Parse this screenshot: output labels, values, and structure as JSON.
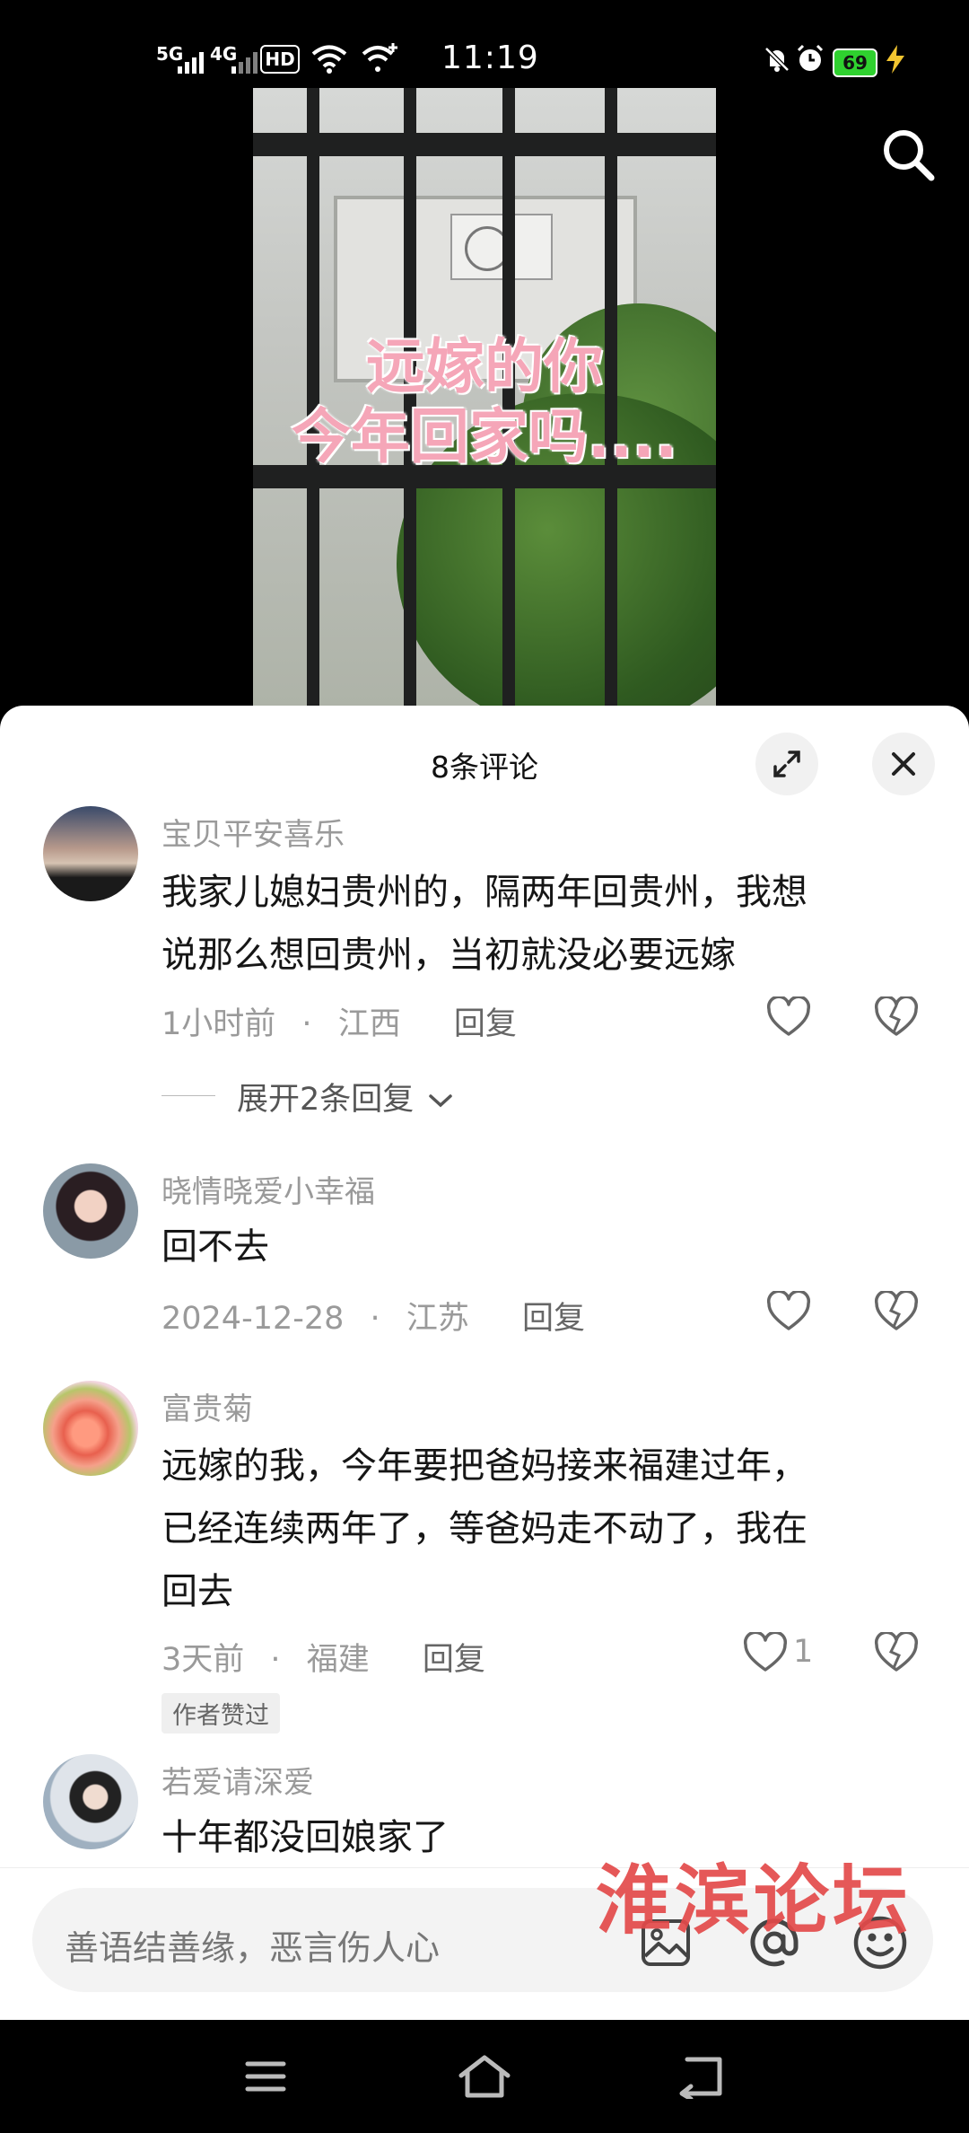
{
  "status_bar": {
    "time": "11:19",
    "network_1": "5G",
    "network_2": "4G",
    "hd_label": "HD",
    "battery": "69"
  },
  "video": {
    "overlay_line1": "远嫁的你",
    "overlay_line2": "今年回家吗...."
  },
  "comments_panel": {
    "title": "8条评论",
    "comments": [
      {
        "username": "宝贝平安喜乐",
        "text_lines": [
          "我家儿媳妇贵州的，隔两年回贵州，我想",
          "说那么想回贵州，当初就没必要远嫁"
        ],
        "time": "1小时前",
        "location": "江西",
        "reply": "回复",
        "expand": "展开2条回复"
      },
      {
        "username": "晓情晓爱小幸福",
        "text_lines": [
          "回不去"
        ],
        "time": "2024-12-28",
        "location": "江苏",
        "reply": "回复"
      },
      {
        "username": "富贵菊",
        "text_lines": [
          "远嫁的我，今年要把爸妈接来福建过年，",
          "已经连续两年了，等爸妈走不动了，我在",
          "回去"
        ],
        "time": "3天前",
        "location": "福建",
        "reply": "回复",
        "likes": "1",
        "badge": "作者赞过"
      },
      {
        "username": "若爱请深爱",
        "text_lines": [
          "十年都没回娘家了"
        ]
      }
    ],
    "separator_dot": "·"
  },
  "input": {
    "placeholder": "善语结善缘，恶言伤人心"
  },
  "watermark": "淮滨论坛",
  "icons": [
    "search-icon",
    "expand-icon",
    "close-icon",
    "heart-icon",
    "broken-heart-icon",
    "chevron-down-icon",
    "image-icon",
    "at-icon",
    "emoji-icon",
    "menu-icon",
    "home-icon",
    "back-icon"
  ],
  "colors": {
    "accent_battery": "#2fd12f",
    "watermark": "#e34a4a",
    "overlay_text": "#f5a6b8"
  }
}
